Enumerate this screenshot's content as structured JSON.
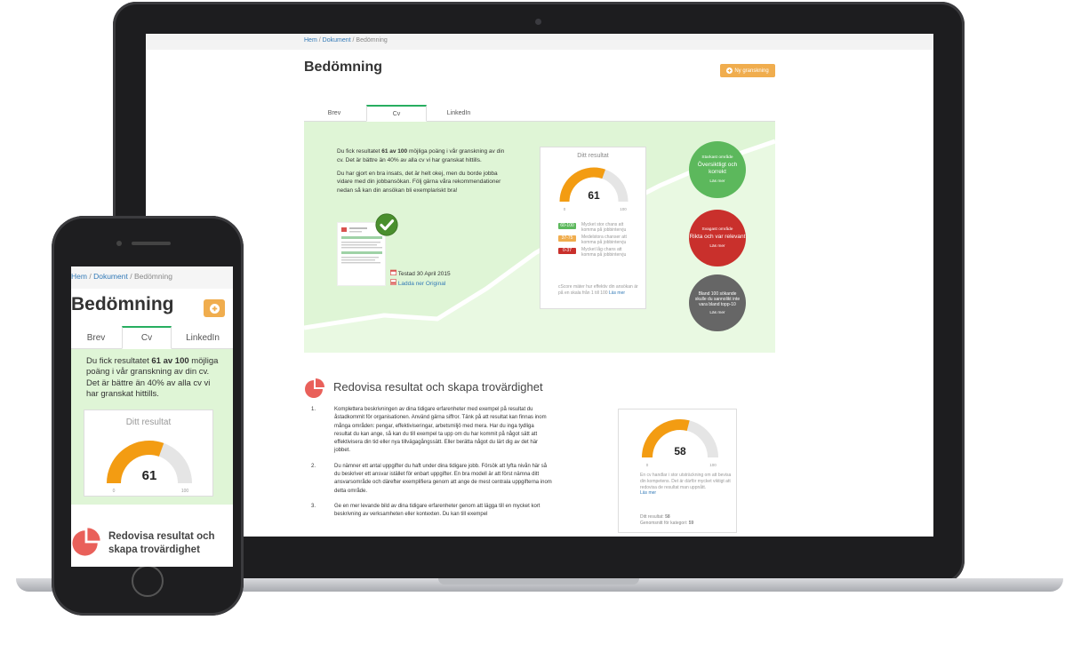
{
  "breadcrumb": {
    "home": "Hem",
    "separator": "/",
    "document": "Dokument",
    "current": "Bedömning"
  },
  "page_title": "Bedömning",
  "new_review_button": "Ny granskning",
  "tabs": [
    {
      "label": "Brev"
    },
    {
      "label": "Cv"
    },
    {
      "label": "LinkedIn"
    }
  ],
  "intro": {
    "p1_before": "Du fick resultatet",
    "p1_score": "61 av 100",
    "p1_after": "möjliga poäng i vår granskning av din cv. Det är bättre än 40% av alla cv vi har granskat hittills.",
    "p2": "Du har gjort en bra insats, det är helt okej, men du borde jobba vidare med din jobbansökan. Följ gärna våra rekommendationer nedan så kan din ansökan bli exemplariskt bra!"
  },
  "doc_meta": {
    "tested": "Testad 30 April 2015",
    "download": "Ladda ner Original"
  },
  "result_panel": {
    "title": "Ditt resultat",
    "score": "61",
    "score_value": 61,
    "min": "0",
    "max": "100",
    "legend": [
      {
        "range": "60-100",
        "color": "#5cb85c",
        "text": "Mycket stor chans att komma på jobbintervju"
      },
      {
        "range": "37-75",
        "color": "#f0ad4e",
        "text": "Medelstora chanser att komma på jobbintervju"
      },
      {
        "range": "0-37",
        "color": "#c9302c",
        "text": "Mycket låg chans att komma på jobbintervju"
      }
    ],
    "footnote": "cScore mäter hur effektiv din ansökan är på en skala från 1 till 100",
    "read_more": "Läs mer"
  },
  "circles": [
    {
      "small": "Starkast område",
      "big": "Översiktligt och korrekt",
      "link": "Läs mer",
      "color": "#5cb85c"
    },
    {
      "small": "Svagast område",
      "big": "Rikta och var relevant",
      "link": "Läs mer",
      "color": "#c9302c"
    },
    {
      "small": "",
      "big": "Bland 100 sökande skulle du sannolikt inte vara bland topp-10",
      "link": "Läs mer",
      "color": "#666666"
    }
  ],
  "section": {
    "title": "Redovisa resultat och skapa trovärdighet",
    "items": [
      {
        "num": "1.",
        "text": "Komplettera beskrivningen av dina tidigare erfarenheter med exempel på resultat du åstadkommit för organisationen. Använd gärna siffror. Tänk på att resultat kan finnas inom många områden: pengar, effektiviseringar, arbetsmiljö med mera. Har du inga tydliga resultat du kan ange, så kan du till exempel ta upp om du har kommit på något sätt att effektivisera din tid eller nya tillvägagångssätt. Eller berätta något du lärt dig av det här jobbet."
      },
      {
        "num": "2.",
        "text": "Du nämner ett antal uppgifter du haft under dina tidigare jobb. Försök att lyfta nivån här så du beskriver ett ansvar istället för enbart uppgifter. En bra modell är att först nämna ditt ansvarsområde och därefter exemplifiera genom att ange de mest centrala uppgifterna inom detta område."
      },
      {
        "num": "3.",
        "text": "Ge en mer levande bild av dina tidigare erfarenheter genom att lägga till en mycket kort beskrivning av verksamheten eller kontexten. Du kan till exempel"
      }
    ],
    "score_panel": {
      "score": "58",
      "score_value": 58,
      "min": "0",
      "max": "100",
      "text": "En cv handlar i stor utsträckning om att bevisa din kompetens. Det är därför mycket viktigt att redovisa de resultat man uppnått.",
      "read_more": "Läs mer",
      "your_label": "Ditt resultat:",
      "your_value": "58",
      "avg_label": "Genomsnitt för kategori:",
      "avg_value": "59"
    }
  },
  "colors": {
    "accent_green": "#27ae60",
    "orange": "#f0ad4e",
    "panel_green": "#dff5d6",
    "link": "#337ab7"
  }
}
